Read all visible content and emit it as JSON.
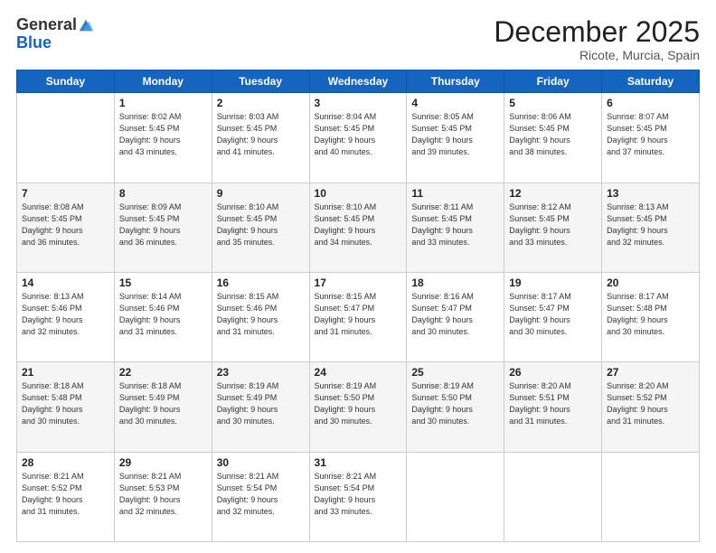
{
  "logo": {
    "general": "General",
    "blue": "Blue"
  },
  "header": {
    "month": "December 2025",
    "location": "Ricote, Murcia, Spain"
  },
  "days": [
    "Sunday",
    "Monday",
    "Tuesday",
    "Wednesday",
    "Thursday",
    "Friday",
    "Saturday"
  ],
  "weeks": [
    [
      {
        "day": "",
        "info": ""
      },
      {
        "day": "1",
        "info": "Sunrise: 8:02 AM\nSunset: 5:45 PM\nDaylight: 9 hours\nand 43 minutes."
      },
      {
        "day": "2",
        "info": "Sunrise: 8:03 AM\nSunset: 5:45 PM\nDaylight: 9 hours\nand 41 minutes."
      },
      {
        "day": "3",
        "info": "Sunrise: 8:04 AM\nSunset: 5:45 PM\nDaylight: 9 hours\nand 40 minutes."
      },
      {
        "day": "4",
        "info": "Sunrise: 8:05 AM\nSunset: 5:45 PM\nDaylight: 9 hours\nand 39 minutes."
      },
      {
        "day": "5",
        "info": "Sunrise: 8:06 AM\nSunset: 5:45 PM\nDaylight: 9 hours\nand 38 minutes."
      },
      {
        "day": "6",
        "info": "Sunrise: 8:07 AM\nSunset: 5:45 PM\nDaylight: 9 hours\nand 37 minutes."
      }
    ],
    [
      {
        "day": "7",
        "info": "Sunrise: 8:08 AM\nSunset: 5:45 PM\nDaylight: 9 hours\nand 36 minutes."
      },
      {
        "day": "8",
        "info": "Sunrise: 8:09 AM\nSunset: 5:45 PM\nDaylight: 9 hours\nand 36 minutes."
      },
      {
        "day": "9",
        "info": "Sunrise: 8:10 AM\nSunset: 5:45 PM\nDaylight: 9 hours\nand 35 minutes."
      },
      {
        "day": "10",
        "info": "Sunrise: 8:10 AM\nSunset: 5:45 PM\nDaylight: 9 hours\nand 34 minutes."
      },
      {
        "day": "11",
        "info": "Sunrise: 8:11 AM\nSunset: 5:45 PM\nDaylight: 9 hours\nand 33 minutes."
      },
      {
        "day": "12",
        "info": "Sunrise: 8:12 AM\nSunset: 5:45 PM\nDaylight: 9 hours\nand 33 minutes."
      },
      {
        "day": "13",
        "info": "Sunrise: 8:13 AM\nSunset: 5:45 PM\nDaylight: 9 hours\nand 32 minutes."
      }
    ],
    [
      {
        "day": "14",
        "info": "Sunrise: 8:13 AM\nSunset: 5:46 PM\nDaylight: 9 hours\nand 32 minutes."
      },
      {
        "day": "15",
        "info": "Sunrise: 8:14 AM\nSunset: 5:46 PM\nDaylight: 9 hours\nand 31 minutes."
      },
      {
        "day": "16",
        "info": "Sunrise: 8:15 AM\nSunset: 5:46 PM\nDaylight: 9 hours\nand 31 minutes."
      },
      {
        "day": "17",
        "info": "Sunrise: 8:15 AM\nSunset: 5:47 PM\nDaylight: 9 hours\nand 31 minutes."
      },
      {
        "day": "18",
        "info": "Sunrise: 8:16 AM\nSunset: 5:47 PM\nDaylight: 9 hours\nand 30 minutes."
      },
      {
        "day": "19",
        "info": "Sunrise: 8:17 AM\nSunset: 5:47 PM\nDaylight: 9 hours\nand 30 minutes."
      },
      {
        "day": "20",
        "info": "Sunrise: 8:17 AM\nSunset: 5:48 PM\nDaylight: 9 hours\nand 30 minutes."
      }
    ],
    [
      {
        "day": "21",
        "info": "Sunrise: 8:18 AM\nSunset: 5:48 PM\nDaylight: 9 hours\nand 30 minutes."
      },
      {
        "day": "22",
        "info": "Sunrise: 8:18 AM\nSunset: 5:49 PM\nDaylight: 9 hours\nand 30 minutes."
      },
      {
        "day": "23",
        "info": "Sunrise: 8:19 AM\nSunset: 5:49 PM\nDaylight: 9 hours\nand 30 minutes."
      },
      {
        "day": "24",
        "info": "Sunrise: 8:19 AM\nSunset: 5:50 PM\nDaylight: 9 hours\nand 30 minutes."
      },
      {
        "day": "25",
        "info": "Sunrise: 8:19 AM\nSunset: 5:50 PM\nDaylight: 9 hours\nand 30 minutes."
      },
      {
        "day": "26",
        "info": "Sunrise: 8:20 AM\nSunset: 5:51 PM\nDaylight: 9 hours\nand 31 minutes."
      },
      {
        "day": "27",
        "info": "Sunrise: 8:20 AM\nSunset: 5:52 PM\nDaylight: 9 hours\nand 31 minutes."
      }
    ],
    [
      {
        "day": "28",
        "info": "Sunrise: 8:21 AM\nSunset: 5:52 PM\nDaylight: 9 hours\nand 31 minutes."
      },
      {
        "day": "29",
        "info": "Sunrise: 8:21 AM\nSunset: 5:53 PM\nDaylight: 9 hours\nand 32 minutes."
      },
      {
        "day": "30",
        "info": "Sunrise: 8:21 AM\nSunset: 5:54 PM\nDaylight: 9 hours\nand 32 minutes."
      },
      {
        "day": "31",
        "info": "Sunrise: 8:21 AM\nSunset: 5:54 PM\nDaylight: 9 hours\nand 33 minutes."
      },
      {
        "day": "",
        "info": ""
      },
      {
        "day": "",
        "info": ""
      },
      {
        "day": "",
        "info": ""
      }
    ]
  ]
}
